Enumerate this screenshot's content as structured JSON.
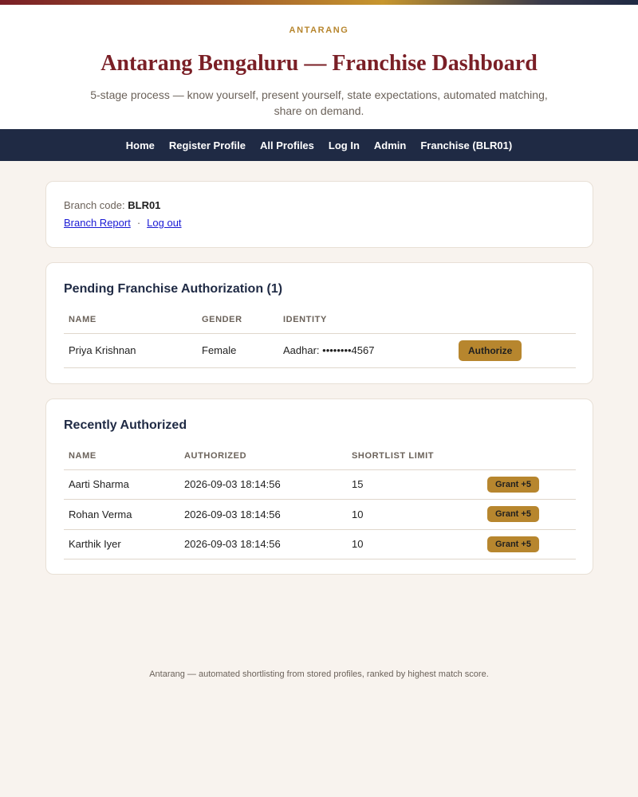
{
  "brand": "ANTARANG",
  "title": "Antarang Bengaluru — Franchise Dashboard",
  "subtitle": "5-stage process — know yourself, present yourself, state expectations, automated matching, share on demand.",
  "nav": [
    "Home",
    "Register Profile",
    "All Profiles",
    "Log In",
    "Admin",
    "Franchise (BLR01)"
  ],
  "branch": {
    "label": "Branch code:",
    "code": "BLR01",
    "report_link": "Branch Report",
    "separator": "·",
    "logout_link": "Log out"
  },
  "pending": {
    "heading": "Pending Franchise Authorization (1)",
    "columns": [
      "NAME",
      "GENDER",
      "IDENTITY",
      ""
    ],
    "rows": [
      {
        "name": "Priya Krishnan",
        "gender": "Female",
        "identity": "Aadhar: ••••••••4567",
        "action": "Authorize"
      }
    ]
  },
  "recent": {
    "heading": "Recently Authorized",
    "columns": [
      "NAME",
      "AUTHORIZED",
      "SHORTLIST LIMIT",
      ""
    ],
    "rows": [
      {
        "name": "Aarti Sharma",
        "authorized": "2026-09-03 18:14:56",
        "limit": "15",
        "action": "Grant +5"
      },
      {
        "name": "Rohan Verma",
        "authorized": "2026-09-03 18:14:56",
        "limit": "10",
        "action": "Grant +5"
      },
      {
        "name": "Karthik Iyer",
        "authorized": "2026-09-03 18:14:56",
        "limit": "10",
        "action": "Grant +5"
      }
    ]
  },
  "footer": "Antarang — automated shortlisting from stored profiles, ranked by highest match score.",
  "colors": {
    "accent": "#b7862e",
    "brand": "#7a1f26",
    "nav_bg": "#1f2a44",
    "page_bg": "#f8f3ee"
  }
}
